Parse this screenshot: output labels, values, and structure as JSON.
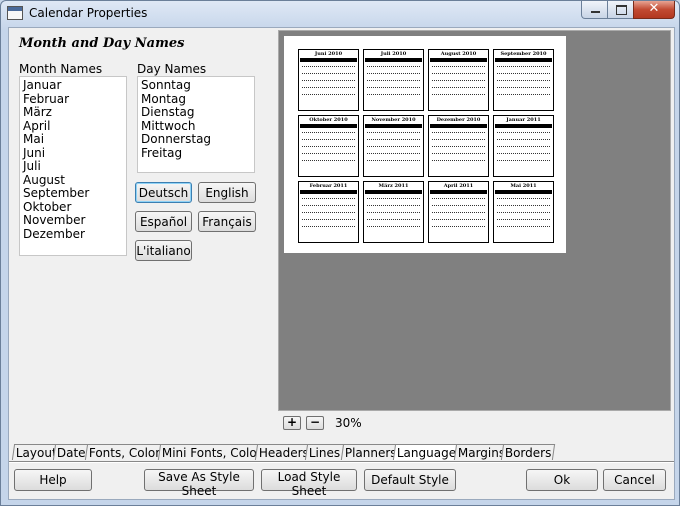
{
  "window": {
    "title": "Calendar Properties"
  },
  "section_heading": "Month and Day Names",
  "month_names": {
    "label": "Month Names",
    "items": [
      "Januar",
      "Februar",
      "März",
      "April",
      "Mai",
      "Juni",
      "Juli",
      "August",
      "September",
      "Oktober",
      "November",
      "Dezember"
    ]
  },
  "day_names": {
    "label": "Day Names",
    "items": [
      "Sonntag",
      "Montag",
      "Dienstag",
      "Mittwoch",
      "Donnerstag",
      "Freitag"
    ]
  },
  "language_buttons": {
    "deutsch": "Deutsch",
    "english": "English",
    "espanol": "Español",
    "francais": "Français",
    "italiano": "L'italiano"
  },
  "preview": {
    "months": [
      "Juni 2010",
      "Juli 2010",
      "August 2010",
      "September 2010",
      "Oktober 2010",
      "November 2010",
      "Dezember 2010",
      "Januar 2011",
      "Februar 2011",
      "März 2011",
      "April 2011",
      "Mai 2011"
    ],
    "dow_letters": "S M D M D F S",
    "zoom_level": "30%"
  },
  "tabs": [
    "Layout",
    "Date",
    "Fonts, Colors",
    "Mini Fonts, Colors",
    "Headers",
    "Lines",
    "Planners",
    "Language",
    "Margins",
    "Borders"
  ],
  "selected_tab": "Language",
  "footer_buttons": {
    "help": "Help",
    "save_style": "Save As Style Sheet",
    "load_style": "Load Style Sheet",
    "default_style": "Default Style",
    "ok": "Ok",
    "cancel": "Cancel"
  }
}
